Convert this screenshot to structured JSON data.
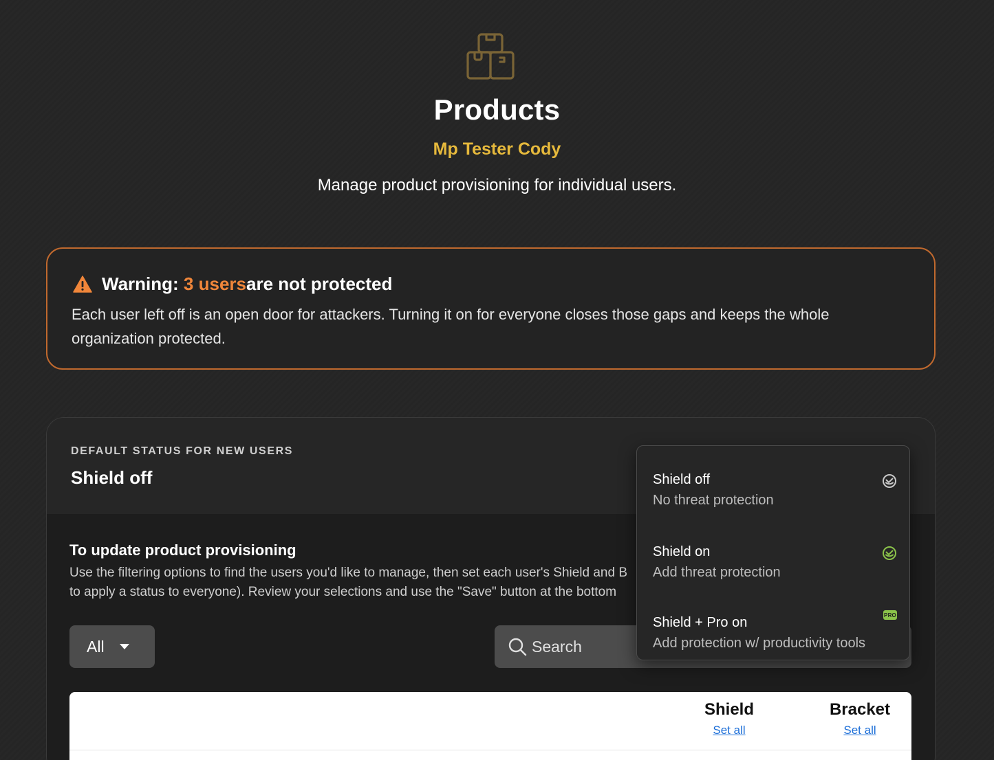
{
  "header": {
    "icon": "boxes-icon",
    "title": "Products",
    "org_name": "Mp Tester Cody",
    "subtitle": "Manage product provisioning for individual users."
  },
  "warning": {
    "prefix": "Warning: ",
    "highlight": "3 users",
    "suffix": " are not protected",
    "body": "Each user left off is an open door for attackers. Turning it on for everyone closes those gaps and keeps the whole organization protected.",
    "accent_color": "#f0863a",
    "border_color": "#c0692e"
  },
  "default_status": {
    "label": "DEFAULT STATUS FOR NEW USERS",
    "value": "Shield off"
  },
  "update": {
    "title": "To update product provisioning",
    "line1": "Use the filtering options to find the users you'd like to manage, then set each user's Shield and B",
    "line2": "to apply a status to everyone). Review your selections and use the \"Save\" button at the bottom"
  },
  "filter": {
    "selected": "All"
  },
  "search": {
    "placeholder": "Search"
  },
  "table": {
    "columns": [
      {
        "label": "Shield",
        "action": "Set all"
      },
      {
        "label": "Bracket",
        "action": "Set all"
      }
    ]
  },
  "dropdown": {
    "options": [
      {
        "title": "Shield off",
        "description": "No threat protection",
        "icon": "shield-off-check-icon"
      },
      {
        "title": "Shield on",
        "description": "Add threat protection",
        "icon": "shield-on-check-icon",
        "color": "#8bc34a"
      },
      {
        "title": "Shield + Pro on",
        "description": "Add protection w/ productivity tools",
        "icon": "pro-badge-icon",
        "badge": "PRO",
        "color": "#8bc34a"
      }
    ]
  }
}
